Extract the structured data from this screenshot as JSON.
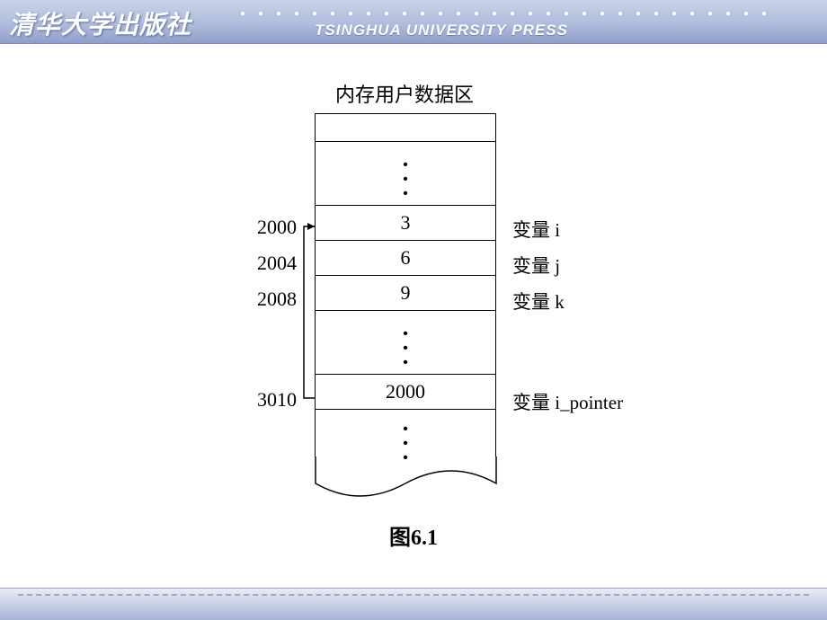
{
  "header": {
    "publisher_cn": "清华大学出版社",
    "publisher_en": "TSINGHUA UNIVERSITY PRESS"
  },
  "diagram": {
    "title": "内存用户数据区",
    "rows": [
      {
        "addr": "2000",
        "value": "3",
        "label": "变量 i"
      },
      {
        "addr": "2004",
        "value": "6",
        "label": "变量 j"
      },
      {
        "addr": "2008",
        "value": "9",
        "label": "变量 k"
      },
      {
        "addr": "3010",
        "value": "2000",
        "label": "变量 i_pointer"
      }
    ],
    "caption": "图6.1"
  }
}
